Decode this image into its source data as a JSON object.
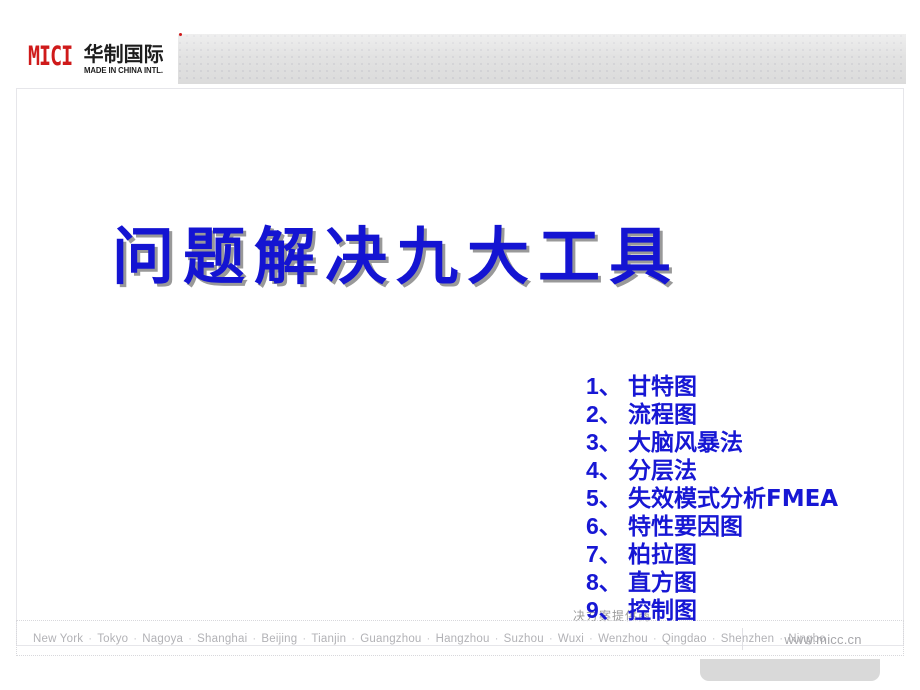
{
  "header": {
    "logo": {
      "mark_text": "MICI",
      "cn_name": "华制国际",
      "en_name": "MADE IN CHINA INTL.",
      "mark_color": "#cf1a1a"
    }
  },
  "slide": {
    "title": "问题解决九大工具",
    "title_color": "#1414d2",
    "tools": [
      {
        "num": "1、",
        "label": "甘特图"
      },
      {
        "num": "2、",
        "label": "流程图"
      },
      {
        "num": "3、",
        "label": "大脑风暴法"
      },
      {
        "num": "4、",
        "label": "分层法"
      },
      {
        "num": "5、",
        "label": "失效模式分析FMEA"
      },
      {
        "num": "6、",
        "label": "特性要因图"
      },
      {
        "num": "7、",
        "label": "柏拉图"
      },
      {
        "num": "8、",
        "label": "直方图"
      },
      {
        "num": "9、",
        "label": "控制图"
      }
    ]
  },
  "footer": {
    "tagline": "决方案提供商",
    "cities": [
      "New York",
      "Tokyo",
      "Nagoya",
      "Shanghai",
      "Beijing",
      "Tianjin",
      "Guangzhou",
      "Hangzhou",
      "Suzhou",
      "Wuxi",
      "Wenzhou",
      "Qingdao",
      "Shenzhen",
      "Ningbo"
    ],
    "separator": "·",
    "url": "www.micc.cn"
  }
}
